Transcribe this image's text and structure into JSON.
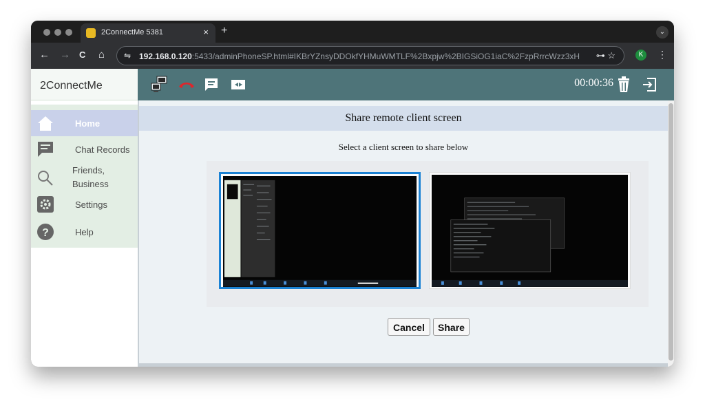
{
  "browser": {
    "tab_title": "2ConnectMe 5381",
    "tab_close": "×",
    "new_tab": "+",
    "url_host": "192.168.0.120",
    "url_rest": ":5433/adminPhoneSP.html#IKBrYZnsyDDOkfYHMuWMTLF%2Bxpjw%2BIGSiOG1iaC%2FzpRrrcWzz3xH4...",
    "profile_initial": "K",
    "nav_back": "←",
    "nav_forward": "→",
    "nav_reload": "C",
    "nav_home": "⌂",
    "tune_icon": "⇋",
    "omnibox_icons": "⊶ ☆",
    "kebab": "⋮",
    "menu_chevron": "⌄"
  },
  "app": {
    "brand": "2ConnectMe",
    "timer": "00:00:36",
    "sidebar": [
      {
        "label": "Home",
        "icon": "home-icon"
      },
      {
        "label": "Chat Records",
        "icon": "chat-icon"
      },
      {
        "label": "Friends,",
        "label2": "Business",
        "icon": "search-icon"
      },
      {
        "label": "Settings",
        "icon": "gear-icon"
      },
      {
        "label": "Help",
        "icon": "help-icon"
      }
    ],
    "header_icons": [
      "screen-share-icon",
      "hang-up-icon",
      "message-icon",
      "video-icon",
      "trash-icon",
      "exit-icon"
    ]
  },
  "dialog": {
    "title": "Share remote client screen",
    "subtitle": "Select a client screen to share below",
    "cancel_label": "Cancel",
    "share_label": "Share"
  },
  "colors": {
    "header_bar": "#4e7479",
    "selection": "#1b82d4",
    "sidebar_active": "#c9d1ea",
    "sidebar_bg": "#e3eee4"
  }
}
